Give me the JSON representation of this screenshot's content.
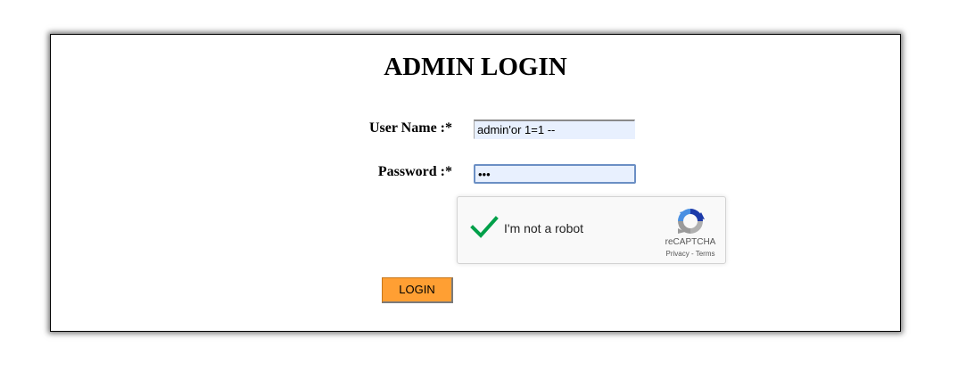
{
  "header": {
    "title": "ADMIN LOGIN"
  },
  "form": {
    "username_label": "User Name :*",
    "username_value": "admin'or 1=1 --",
    "password_label": "Password :*",
    "password_value": "•••",
    "login_label": "LOGIN"
  },
  "recaptcha": {
    "checkbox_label": "I'm not a robot",
    "checked": true,
    "brand": "reCAPTCHA",
    "privacy_label": "Privacy",
    "separator": " - ",
    "terms_label": "Terms",
    "icons": {
      "check": "checkmark-icon",
      "logo": "recaptcha-logo-icon"
    }
  },
  "colors": {
    "login_button": "#ff9f33",
    "check": "#00a04a",
    "input_fill": "#e8f0fe"
  }
}
